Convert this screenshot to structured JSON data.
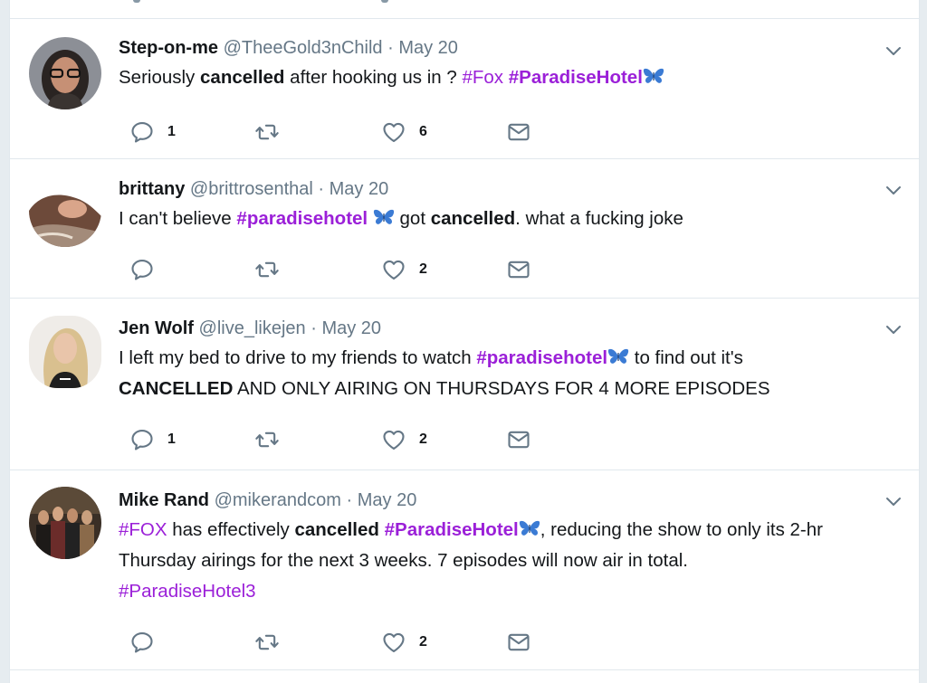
{
  "tweets": [
    {
      "name": "Step-on-me",
      "handle": "@TheeGold3nChild",
      "separator": "·",
      "date": "May 20",
      "text": {
        "p1": "Seriously ",
        "b1": "cancelled",
        "p2": " after hooking us in ? ",
        "h1": "#Fox",
        "h2": "#ParadiseHotel"
      },
      "replies": "1",
      "likes": "6"
    },
    {
      "name": "brittany",
      "handle": "@brittrosenthal",
      "separator": "·",
      "date": "May 20",
      "text": {
        "p1": "I can't believe ",
        "h1": "#paradisehotel",
        "p2": " got ",
        "b1": "cancelled",
        "p3": ". what a fucking joke"
      },
      "replies": "",
      "likes": "2"
    },
    {
      "name": "Jen Wolf",
      "handle": "@live_likejen",
      "separator": "·",
      "date": "May 20",
      "text": {
        "p1": "I left my bed to drive to my friends to watch ",
        "h1": "#paradisehotel",
        "p2": " to find out it's",
        "b1": "CANCELLED",
        "p3": " AND ONLY AIRING ON THURSDAYS FOR 4 MORE EPISODES"
      },
      "replies": "1",
      "likes": "2"
    },
    {
      "name": "Mike Rand",
      "handle": "@mikerandcom",
      "separator": "·",
      "date": "May 20",
      "text": {
        "h1": "#FOX",
        "p1": " has effectively ",
        "b1": "cancelled",
        "h2": "#ParadiseHotel",
        "p2": ", reducing the show to only its 2-hr Thursday airings for the next 3 weeks. 7 episodes will now air in total.",
        "h3": "#ParadiseHotel3"
      },
      "replies": "",
      "likes": "2"
    }
  ],
  "icons": {
    "reply": "reply-icon",
    "retweet": "retweet-icon",
    "like": "heart-icon",
    "dm": "envelope-icon",
    "caret": "chevron-down-icon",
    "emoji": "butterfly-icon"
  },
  "colors": {
    "hashtag": "#9b20d8",
    "muted": "#657786",
    "border": "#e1e8ed",
    "butterfly": "#3b7bd4"
  }
}
